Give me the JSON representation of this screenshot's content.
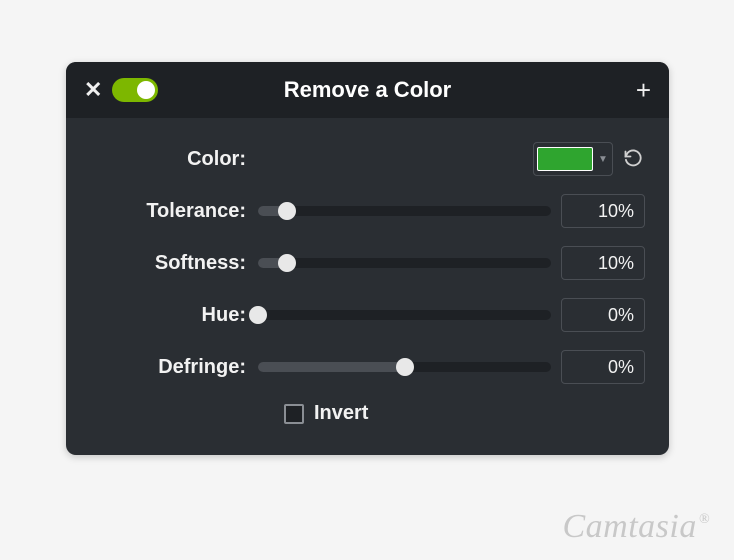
{
  "panel": {
    "title": "Remove a Color",
    "toggle_on": true,
    "color_hex": "#2fa52f",
    "rows": {
      "color": {
        "label": "Color:"
      },
      "tolerance": {
        "label": "Tolerance:",
        "value": "10%",
        "percent": 10
      },
      "softness": {
        "label": "Softness:",
        "value": "10%",
        "percent": 10
      },
      "hue": {
        "label": "Hue:",
        "value": "0%",
        "percent": 0
      },
      "defringe": {
        "label": "Defringe:",
        "value": "0%",
        "percent": 50
      }
    },
    "invert": {
      "label": "Invert",
      "checked": false
    }
  },
  "watermark": "Camtasia"
}
